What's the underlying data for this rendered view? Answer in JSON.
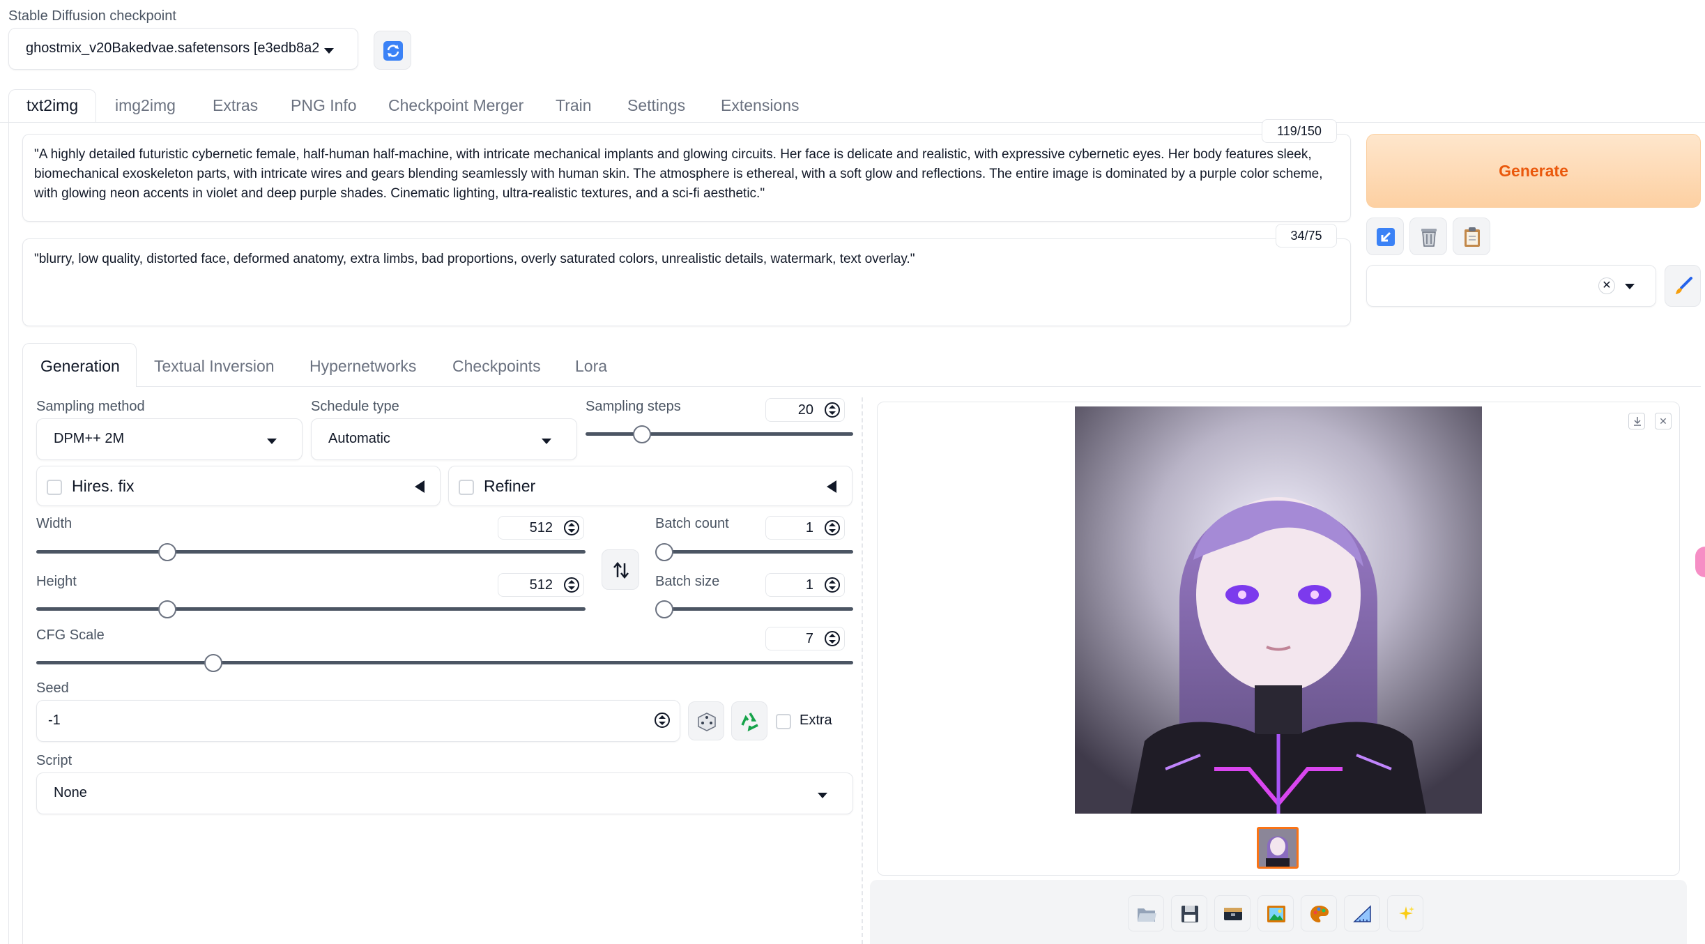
{
  "checkpoint": {
    "label": "Stable Diffusion checkpoint",
    "value": "ghostmix_v20Bakedvae.safetensors [e3edb8a2("
  },
  "main_tabs": [
    "txt2img",
    "img2img",
    "Extras",
    "PNG Info",
    "Checkpoint Merger",
    "Train",
    "Settings",
    "Extensions"
  ],
  "prompt": {
    "text": "\"A highly detailed futuristic cybernetic female, half-human half-machine, with intricate mechanical implants and glowing circuits. Her face is delicate and realistic, with expressive cybernetic eyes. Her body features sleek, biomechanical exoskeleton parts, with intricate wires and gears blending seamlessly with human skin. The atmosphere is ethereal, with a soft glow and reflections. The entire image is dominated by a purple color scheme, with glowing neon accents in violet and deep purple shades. Cinematic lighting, ultra-realistic textures, and a sci-fi aesthetic.\"",
    "token_count": "119/150"
  },
  "negative_prompt": {
    "text": "\"blurry, low quality, distorted face, deformed anatomy, extra limbs, bad proportions, overly saturated colors, unrealistic details, watermark, text overlay.\"",
    "token_count": "34/75"
  },
  "generate_label": "Generate",
  "sub_tabs": [
    "Generation",
    "Textual Inversion",
    "Hypernetworks",
    "Checkpoints",
    "Lora"
  ],
  "generation": {
    "sampling_method_label": "Sampling method",
    "sampling_method": "DPM++ 2M",
    "schedule_type_label": "Schedule type",
    "schedule_type": "Automatic",
    "sampling_steps_label": "Sampling steps",
    "sampling_steps": "20",
    "hires_fix_label": "Hires. fix",
    "refiner_label": "Refiner",
    "width_label": "Width",
    "width": "512",
    "height_label": "Height",
    "height": "512",
    "batch_count_label": "Batch count",
    "batch_count": "1",
    "batch_size_label": "Batch size",
    "batch_size": "1",
    "cfg_label": "CFG Scale",
    "cfg": "7",
    "seed_label": "Seed",
    "seed": "-1",
    "extra_label": "Extra",
    "script_label": "Script",
    "script": "None"
  },
  "slider_levels": {
    "sampling_steps": 0.19,
    "width": 0.23,
    "height": 0.23,
    "batch_count": 0.0,
    "batch_size": 0.0,
    "cfg": 0.21
  },
  "colors": {
    "generate_bg": "#fdd9b5",
    "generate_text": "#ea580c",
    "accent_purple": "#a855f7"
  },
  "icons": [
    "refresh-icon",
    "arrow-icon",
    "trash-icon",
    "clipboard-icon",
    "close-icon",
    "brush-icon",
    "swap-icon",
    "dice-icon",
    "recycle-icon",
    "download-icon",
    "folder-icon",
    "save-icon",
    "zip-icon",
    "image-icon",
    "palette-icon",
    "ruler-icon",
    "sparkle-icon"
  ]
}
